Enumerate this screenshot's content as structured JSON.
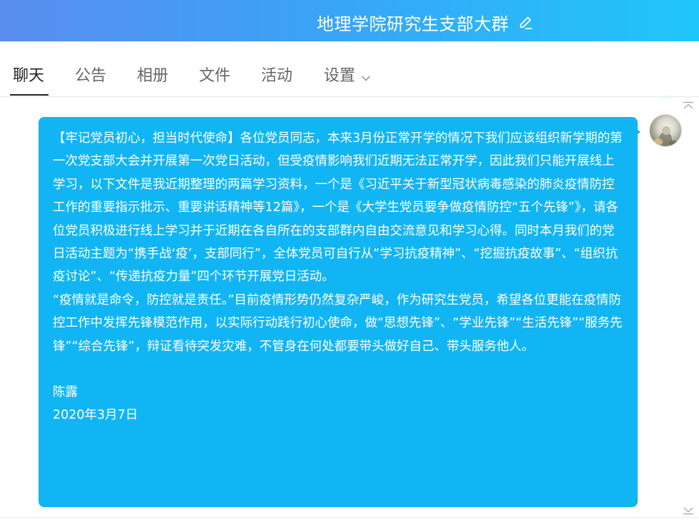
{
  "header": {
    "title": "地理学院研究生支部大群"
  },
  "tabs": [
    {
      "label": "聊天",
      "active": true
    },
    {
      "label": "公告",
      "active": false
    },
    {
      "label": "相册",
      "active": false
    },
    {
      "label": "文件",
      "active": false
    },
    {
      "label": "活动",
      "active": false
    },
    {
      "label": "设置",
      "active": false
    }
  ],
  "icons": {
    "edit": "pencil-icon",
    "settings_dropdown": "chevron-down-icon",
    "call": "phone-icon",
    "scroll_up": "chevron-up-icon",
    "scroll_down": "chevron-down-icon"
  },
  "colors": {
    "bubble": "#12b5f3",
    "phone_bg": "#e3f7ef",
    "phone_icon": "#1bbf7a"
  },
  "message": {
    "para1": "【牢记党员初心，担当时代使命】各位党员同志，本来3月份正常开学的情况下我们应该组织新学期的第一次党支部大会并开展第一次党日活动，但受疫情影响我们近期无法正常开学，因此我们只能开展线上学习，以下文件是我近期整理的两篇学习资料，一个是《习近平关于新型冠状病毒感染的肺炎疫情防控工作的重要指示批示、重要讲话精神等12篇》，一个是《大学生党员要争做疫情防控“五个先锋”》，请各位党员积极进行线上学习并于近期在各自所在的支部群内自由交流意见和学习心得。同时本月我们的党日活动主题为“携手战‘疫’，支部同行”，全体党员可自行从“学习抗疫精神”、“挖掘抗疫故事”、“组织抗疫讨论”、“传递抗疫力量”四个环节开展党日活动。",
    "para2": "“疫情就是命令，防控就是责任。”目前疫情形势仍然复杂严峻，作为研究生党员，希望各位更能在疫情防控工作中发挥先锋模范作用，以实际行动践行初心使命，做“思想先锋”、“学业先锋”“生活先锋”“服务先锋”“综合先锋”，辩证看待突发灾难，不管身在何处都要带头做好自己、带头服务他人。",
    "signature": "陈露",
    "date": "2020年3月7日"
  }
}
